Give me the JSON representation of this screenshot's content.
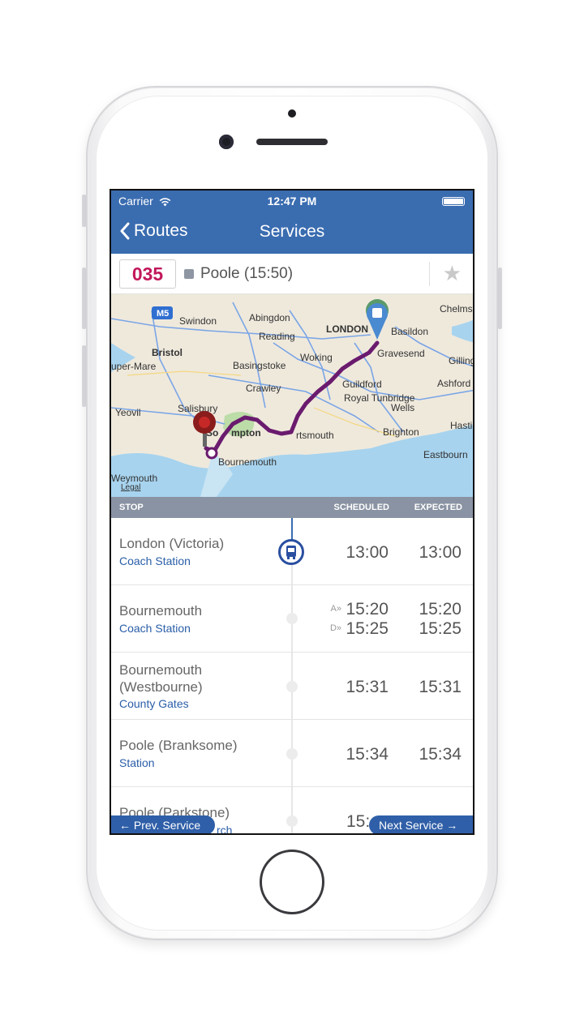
{
  "status_bar": {
    "carrier": "Carrier",
    "time": "12:47 PM"
  },
  "nav": {
    "back_label": "Routes",
    "title": "Services"
  },
  "route": {
    "number": "035",
    "destination": "Poole (15:50)",
    "number_color": "#c2185b"
  },
  "map": {
    "labels": {
      "m5": "M5",
      "swindon": "Swindon",
      "abingdon": "Abingdon",
      "london": "LONDON",
      "basildon": "Basildon",
      "chelms": "Chelms",
      "reading": "Reading",
      "bristol": "Bristol",
      "woking": "Woking",
      "gravesend": "Gravesend",
      "gilling": "Gilling",
      "super_mare": "uper-Mare",
      "basingstoke": "Basingstoke",
      "guildford": "Guildford",
      "ashford": "Ashford",
      "crawley": "Crawley",
      "royal_tunbridge": "Royal Tunbridge",
      "wells": "Wells",
      "salisbury": "Salisbury",
      "yeovil": "Yeovil",
      "hasti": "Hasti",
      "southampton_a": "So",
      "southampton_b": "mpton",
      "portsmouth": "rtsmouth",
      "brighton": "Brighton",
      "eastbourn": "Eastbourn",
      "bournemouth": "Bournemouth",
      "weymouth": "Weymouth",
      "legal": "Legal"
    },
    "route_color": "#6a1b6e"
  },
  "table": {
    "header": {
      "stop": "STOP",
      "scheduled": "SCHEDULED",
      "expected": "EXPECTED"
    },
    "rows": [
      {
        "name": "London (Victoria)",
        "sub": "Coach Station",
        "scheduled": "13:00",
        "expected": "13:00",
        "current": true
      },
      {
        "name": "Bournemouth",
        "sub": "Coach Station",
        "arr_label": "A»",
        "dep_label": "D»",
        "scheduled_arr": "15:20",
        "scheduled_dep": "15:25",
        "expected_arr": "15:20",
        "expected_dep": "15:25"
      },
      {
        "name_line1": "Bournemouth",
        "name_line2": "(Westbourne)",
        "sub": "County Gates",
        "scheduled": "15:31",
        "expected": "15:31"
      },
      {
        "name": "Poole (Branksome)",
        "sub": "Station",
        "scheduled": "15:34",
        "expected": "15:34"
      },
      {
        "name": "Poole (Parkstone)",
        "sub": "rch",
        "scheduled": "15:"
      }
    ]
  },
  "footer": {
    "prev": "← Prev. Service",
    "next": "Next Service →"
  }
}
